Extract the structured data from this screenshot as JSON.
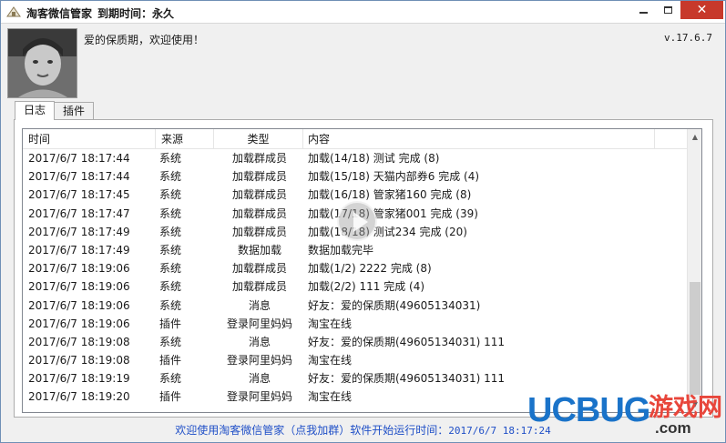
{
  "window": {
    "app_title": "淘客微信管家",
    "expire_label": "到期时间：永久",
    "controls": {
      "minimize": "minimize-icon",
      "maximize": "maximize-icon",
      "close": "close-icon"
    }
  },
  "profile": {
    "greeting": "爱的保质期，欢迎使用！",
    "version": "v.17.6.7"
  },
  "tabs": [
    {
      "label": "日志",
      "active": true
    },
    {
      "label": "插件",
      "active": false
    }
  ],
  "log": {
    "columns": [
      "时间",
      "来源",
      "类型",
      "内容"
    ],
    "rows": [
      {
        "time": "2017/6/7 18:17:44",
        "source": "系统",
        "type": "加载群成员",
        "content": "加载(14/18) 测试 完成 (8)"
      },
      {
        "time": "2017/6/7 18:17:44",
        "source": "系统",
        "type": "加载群成员",
        "content": "加载(15/18) 天猫内部券6 完成 (4)"
      },
      {
        "time": "2017/6/7 18:17:45",
        "source": "系统",
        "type": "加载群成员",
        "content": "加载(16/18) 管家猪160 完成 (8)"
      },
      {
        "time": "2017/6/7 18:17:47",
        "source": "系统",
        "type": "加载群成员",
        "content": "加载(17/18) 管家猪001 完成 (39)"
      },
      {
        "time": "2017/6/7 18:17:49",
        "source": "系统",
        "type": "加载群成员",
        "content": "加载(18/18) 测试234 完成 (20)"
      },
      {
        "time": "2017/6/7 18:17:49",
        "source": "系统",
        "type": "数据加载",
        "content": "数据加载完毕"
      },
      {
        "time": "2017/6/7 18:19:06",
        "source": "系统",
        "type": "加载群成员",
        "content": "加载(1/2) 2222 完成 (8)"
      },
      {
        "time": "2017/6/7 18:19:06",
        "source": "系统",
        "type": "加载群成员",
        "content": "加载(2/2) 111 完成 (4)"
      },
      {
        "time": "2017/6/7 18:19:06",
        "source": "系统",
        "type": "消息",
        "content": "好友：爱的保质期(49605134031)"
      },
      {
        "time": "2017/6/7 18:19:06",
        "source": "插件",
        "type": "登录阿里妈妈",
        "content": "淘宝在线"
      },
      {
        "time": "2017/6/7 18:19:08",
        "source": "系统",
        "type": "消息",
        "content": "好友：爱的保质期(49605134031) 111"
      },
      {
        "time": "2017/6/7 18:19:08",
        "source": "插件",
        "type": "登录阿里妈妈",
        "content": "淘宝在线"
      },
      {
        "time": "2017/6/7 18:19:19",
        "source": "系统",
        "type": "消息",
        "content": "好友：爱的保质期(49605134031) 111"
      },
      {
        "time": "2017/6/7 18:19:20",
        "source": "插件",
        "type": "登录阿里妈妈",
        "content": "淘宝在线"
      }
    ]
  },
  "status": {
    "welcome": "欢迎使用淘客微信管家（点我加群）软件开始运行时间：",
    "start_time": "2017/6/7 18:17:24"
  },
  "watermark": {
    "brand": "UCBUG",
    "cn": "游戏网",
    "domain": ".com"
  },
  "colors": {
    "status_text": "#1f4fc7",
    "close_button": "#c7392b",
    "watermark_blue": "#1a73c9",
    "watermark_red": "#e8463b"
  }
}
